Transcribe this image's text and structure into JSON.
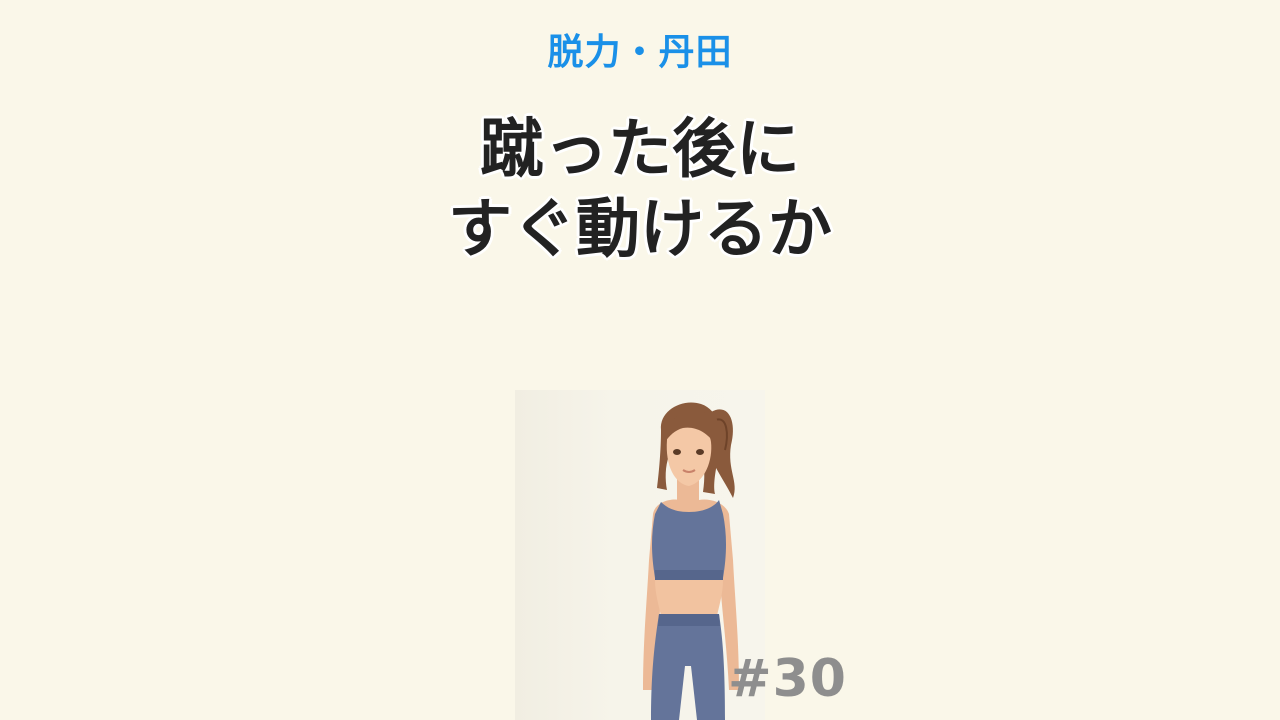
{
  "category": "脱力・丹田",
  "title_lines": [
    "蹴った後に",
    "すぐ動けるか"
  ],
  "episode": "#30",
  "colors": {
    "background": "#faf7e9",
    "category": "#1a90e8",
    "title": "#222222",
    "episode": "#8e8e8e",
    "outfit": "#64749a"
  },
  "illustration": "woman-in-sportswear"
}
